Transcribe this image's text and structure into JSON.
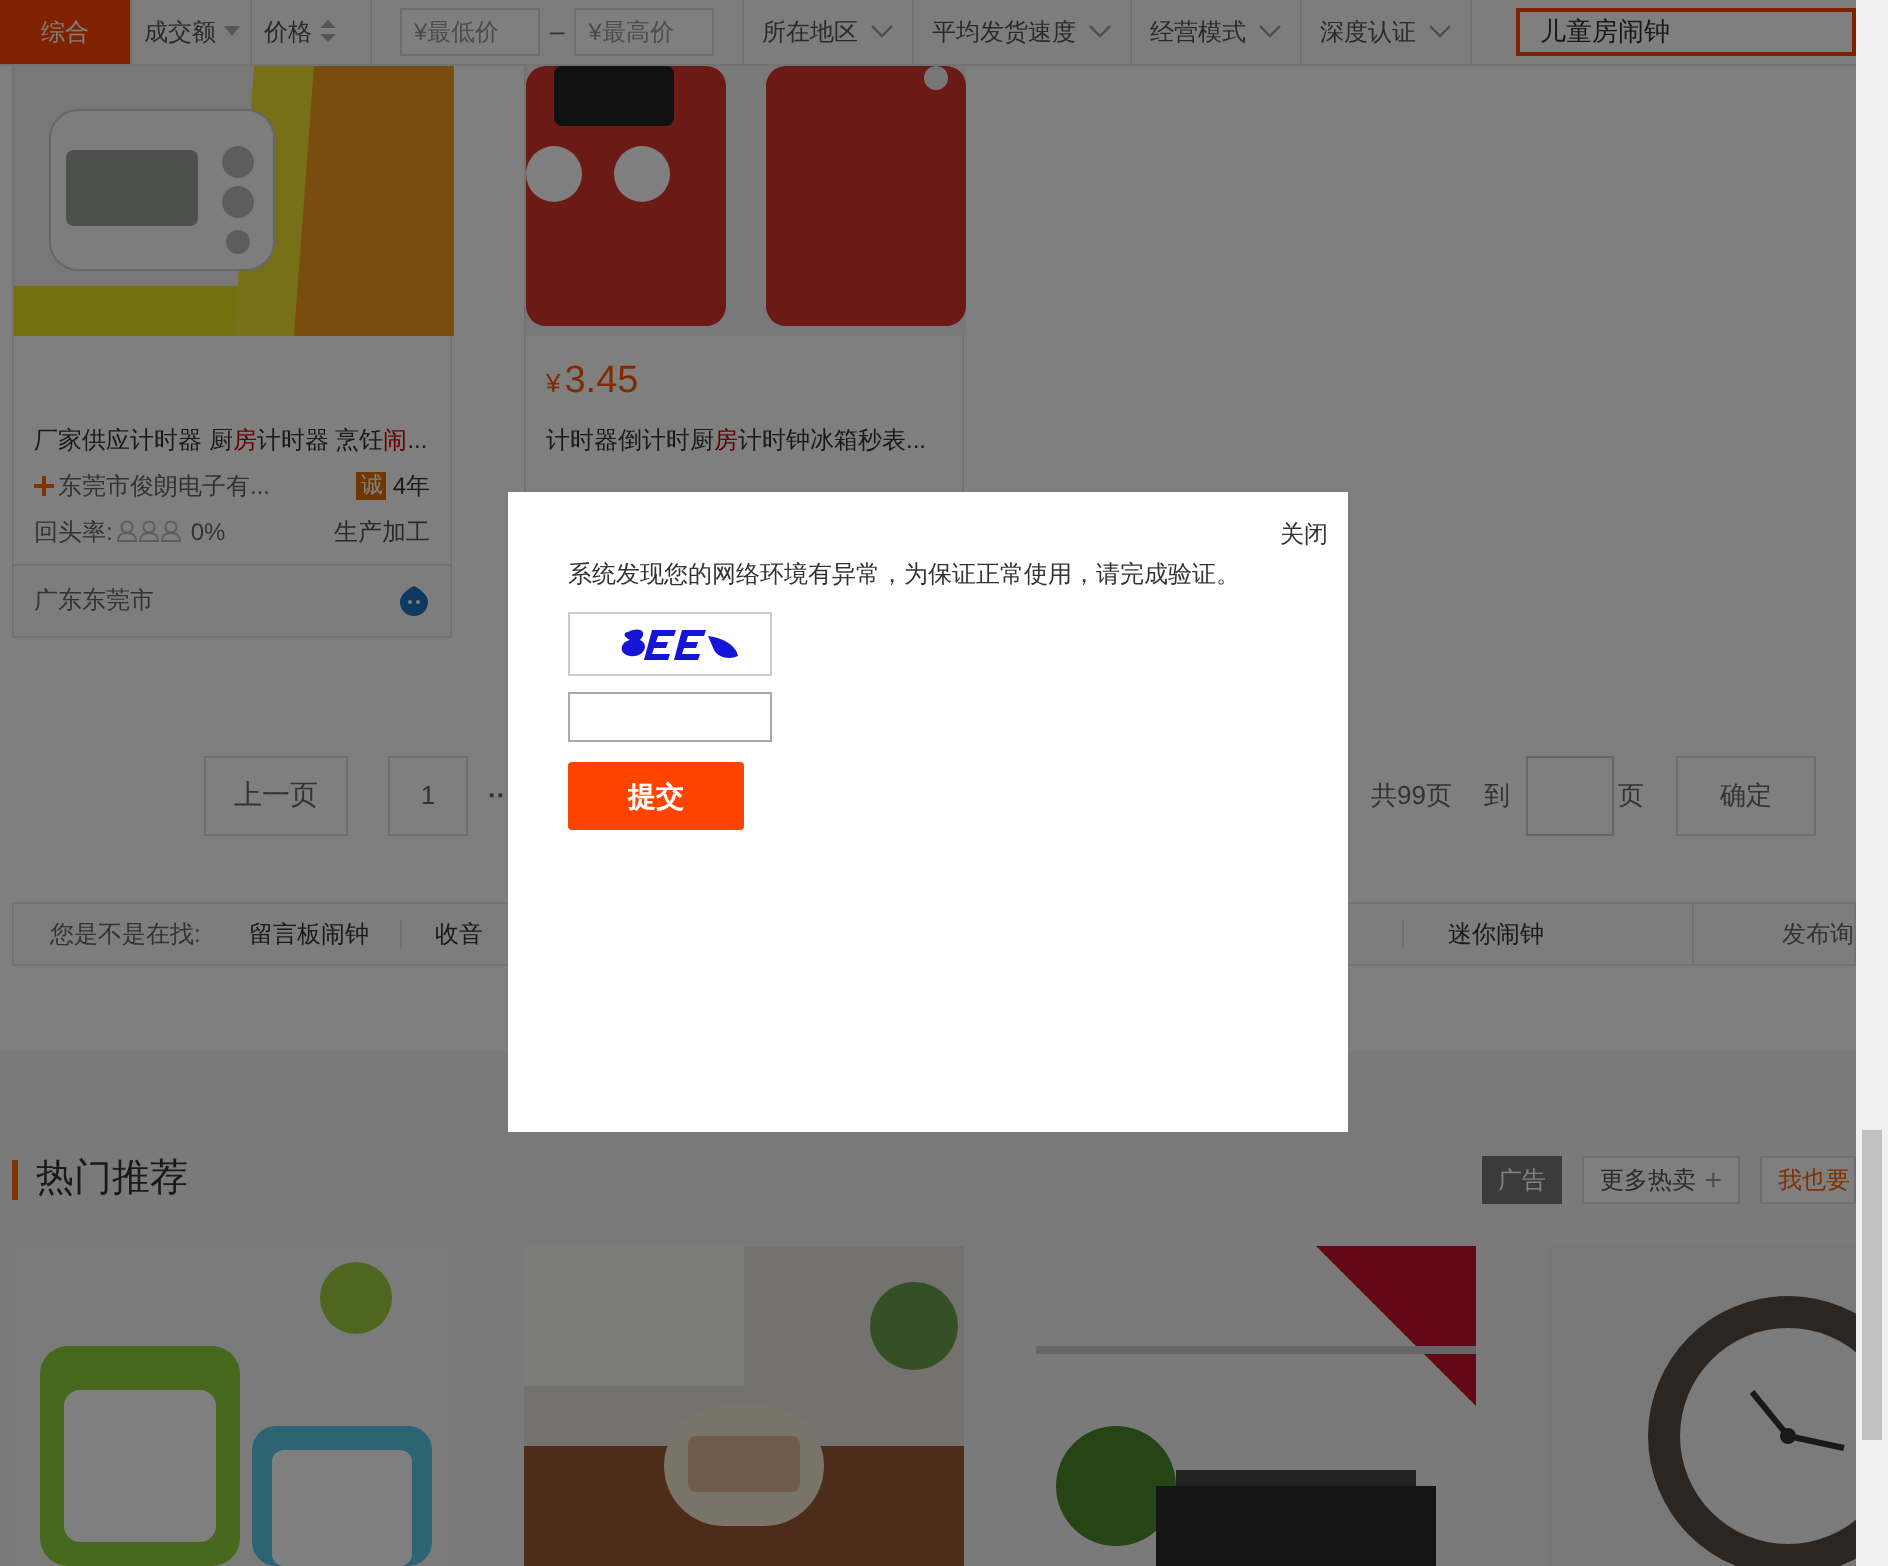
{
  "filter_bar": {
    "tabs": [
      {
        "label": "综合",
        "selected": true,
        "kind": "plain"
      },
      {
        "label": "成交额",
        "selected": false,
        "kind": "dropdown"
      },
      {
        "label": "价格",
        "selected": false,
        "kind": "sort"
      }
    ],
    "price_min": {
      "placeholder": "¥最低价"
    },
    "price_separator": "–",
    "price_max": {
      "placeholder": "¥最高价"
    },
    "filters": [
      "所在地区",
      "平均发货速度",
      "经营模式",
      "深度认证"
    ],
    "search": {
      "value": "儿童房闹钟"
    }
  },
  "products": [
    {
      "image": {
        "kind": "picture"
      },
      "title_parts": [
        {
          "text": "厂家供应计时器 厨",
          "highlight": false
        },
        {
          "text": "房",
          "highlight": true
        },
        {
          "text": "计时器 烹饪",
          "highlight": false
        },
        {
          "text": "闹",
          "highlight": true
        },
        {
          "text": "...",
          "highlight": false
        }
      ],
      "company": "东莞市俊朗电子有...",
      "credit_badge": "诚",
      "credit_years": "4年",
      "repeat_label": "回头率:",
      "stars": 0,
      "repeat_rate": "0%",
      "business_type": "生产加工",
      "location": "广东东莞市"
    },
    {
      "image": {
        "kind": "picture"
      },
      "currency": "¥",
      "price": "3.45",
      "title_parts": [
        {
          "text": "计时器倒计时厨",
          "highlight": false
        },
        {
          "text": "房",
          "highlight": true
        },
        {
          "text": "计时钟冰箱秒表...",
          "highlight": false
        }
      ]
    }
  ],
  "pagination": {
    "prev": "上一页",
    "pages": [
      {
        "label": "1",
        "selected": false
      }
    ],
    "ellipsis": "··",
    "total": "共99页",
    "goto": "到",
    "page_unit": "页",
    "confirm": "确定"
  },
  "suggestions": {
    "label": "您是不是在找:",
    "items": [
      "留言板闹钟",
      "收音"
    ],
    "items_right": [
      "迷你闹钟"
    ],
    "publish": "发布询"
  },
  "hot": {
    "title": "热门推荐",
    "ad": "广告",
    "more": "更多热卖",
    "more_icon": "+",
    "join": "我也要"
  },
  "hot_items": [
    {
      "kind": "picture"
    },
    {
      "kind": "picture"
    },
    {
      "kind": "picture"
    },
    {
      "kind": "picture"
    }
  ],
  "dialog": {
    "close": "关闭",
    "message": "系统发现您的网络环境有异常，为保证正常使用，请完成验证。",
    "captcha": {
      "kind": "picture"
    },
    "submit": "提交"
  }
}
